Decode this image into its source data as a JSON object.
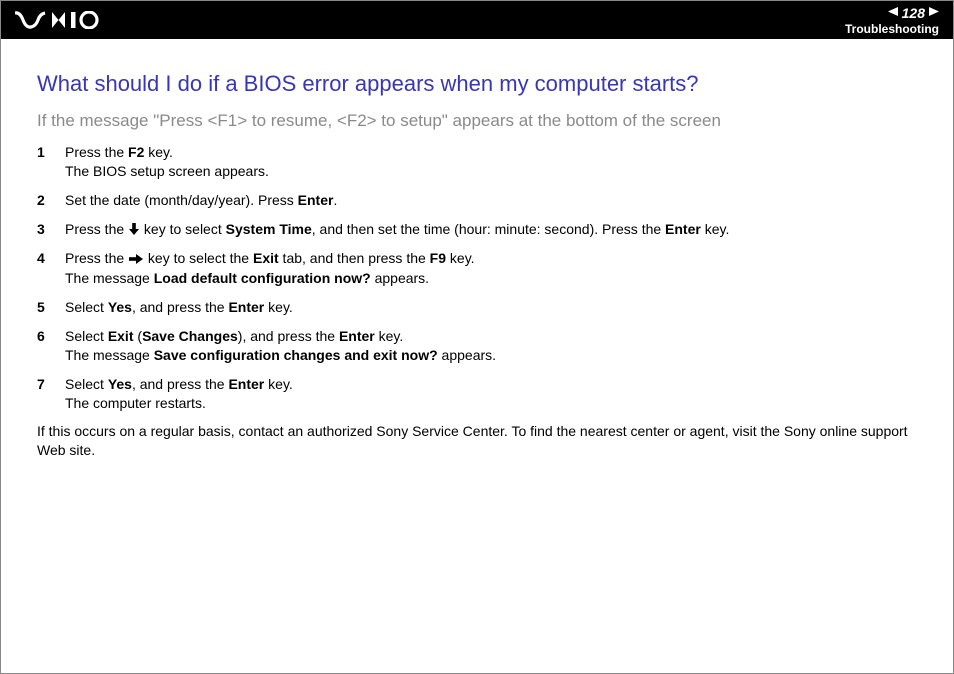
{
  "header": {
    "page_number": "128",
    "section": "Troubleshooting"
  },
  "content": {
    "title": "What should I do if a BIOS error appears when my computer starts?",
    "subtitle": "If the message \"Press <F1> to resume, <F2> to setup\" appears at the bottom of the screen",
    "steps": [
      {
        "num": "1",
        "parts": [
          {
            "t": "Press the "
          },
          {
            "t": "F2",
            "b": true
          },
          {
            "t": " key."
          },
          {
            "br": true
          },
          {
            "t": "The BIOS setup screen appears."
          }
        ]
      },
      {
        "num": "2",
        "parts": [
          {
            "t": "Set the date (month/day/year). Press "
          },
          {
            "t": "Enter",
            "b": true
          },
          {
            "t": "."
          }
        ]
      },
      {
        "num": "3",
        "parts": [
          {
            "t": "Press the "
          },
          {
            "icon": "down"
          },
          {
            "t": " key to select "
          },
          {
            "t": "System Time",
            "b": true
          },
          {
            "t": ", and then set the time (hour: minute: second). Press the "
          },
          {
            "t": "Enter",
            "b": true
          },
          {
            "t": " key."
          }
        ]
      },
      {
        "num": "4",
        "parts": [
          {
            "t": "Press the "
          },
          {
            "icon": "right"
          },
          {
            "t": " key to select the "
          },
          {
            "t": "Exit",
            "b": true
          },
          {
            "t": " tab, and then press the "
          },
          {
            "t": "F9",
            "b": true
          },
          {
            "t": " key."
          },
          {
            "br": true
          },
          {
            "t": "The message "
          },
          {
            "t": "Load default configuration now?",
            "b": true
          },
          {
            "t": " appears."
          }
        ]
      },
      {
        "num": "5",
        "parts": [
          {
            "t": "Select "
          },
          {
            "t": "Yes",
            "b": true
          },
          {
            "t": ", and press the "
          },
          {
            "t": "Enter",
            "b": true
          },
          {
            "t": " key."
          }
        ]
      },
      {
        "num": "6",
        "parts": [
          {
            "t": "Select "
          },
          {
            "t": "Exit",
            "b": true
          },
          {
            "t": " ("
          },
          {
            "t": "Save Changes",
            "b": true
          },
          {
            "t": "), and press the "
          },
          {
            "t": "Enter",
            "b": true
          },
          {
            "t": " key."
          },
          {
            "br": true
          },
          {
            "t": "The message "
          },
          {
            "t": "Save configuration changes and exit now?",
            "b": true
          },
          {
            "t": " appears."
          }
        ]
      },
      {
        "num": "7",
        "parts": [
          {
            "t": "Select "
          },
          {
            "t": "Yes",
            "b": true
          },
          {
            "t": ", and press the "
          },
          {
            "t": "Enter",
            "b": true
          },
          {
            "t": " key."
          },
          {
            "br": true
          },
          {
            "t": "The computer restarts."
          }
        ]
      }
    ],
    "footer": "If this occurs on a regular basis, contact an authorized Sony Service Center. To find the nearest center or agent, visit the Sony online support Web site."
  }
}
